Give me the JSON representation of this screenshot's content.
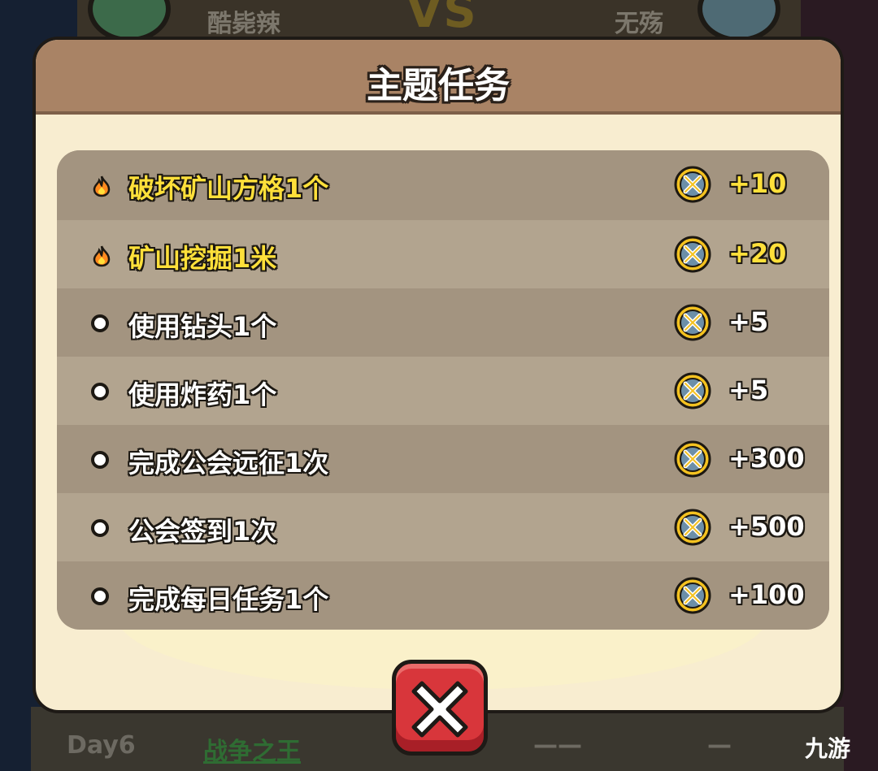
{
  "background": {
    "left_player": "酷毙辣",
    "right_player": "无殇",
    "versus": "VS",
    "bottom": {
      "day": "Day6",
      "title": "战争之王",
      "dash1": "——",
      "dash2": "—"
    }
  },
  "dialog": {
    "title": "主题任务",
    "tasks": [
      {
        "label": "破坏矿山方格1个",
        "reward": "+10",
        "bullet": "fire-icon",
        "highlight": true
      },
      {
        "label": "矿山挖掘1米",
        "reward": "+20",
        "bullet": "fire-icon",
        "highlight": true
      },
      {
        "label": "使用钻头1个",
        "reward": "+5",
        "bullet": "dot",
        "highlight": false
      },
      {
        "label": "使用炸药1个",
        "reward": "+5",
        "bullet": "dot",
        "highlight": false
      },
      {
        "label": "完成公会远征1次",
        "reward": "+300",
        "bullet": "dot",
        "highlight": false
      },
      {
        "label": "公会签到1次",
        "reward": "+500",
        "bullet": "dot",
        "highlight": false
      },
      {
        "label": "完成每日任务1个",
        "reward": "+100",
        "bullet": "dot",
        "highlight": false
      }
    ],
    "reward_icon": "crossed-swords-coin-icon",
    "close_icon": "close-x-icon"
  },
  "watermark": "九游",
  "colors": {
    "header": "#a98365",
    "panel": "#f8edd0",
    "row_dark": "#a39480",
    "row_light": "#b2a48f",
    "highlight_text": "#ffe03a",
    "close_button": "#d8363b"
  }
}
